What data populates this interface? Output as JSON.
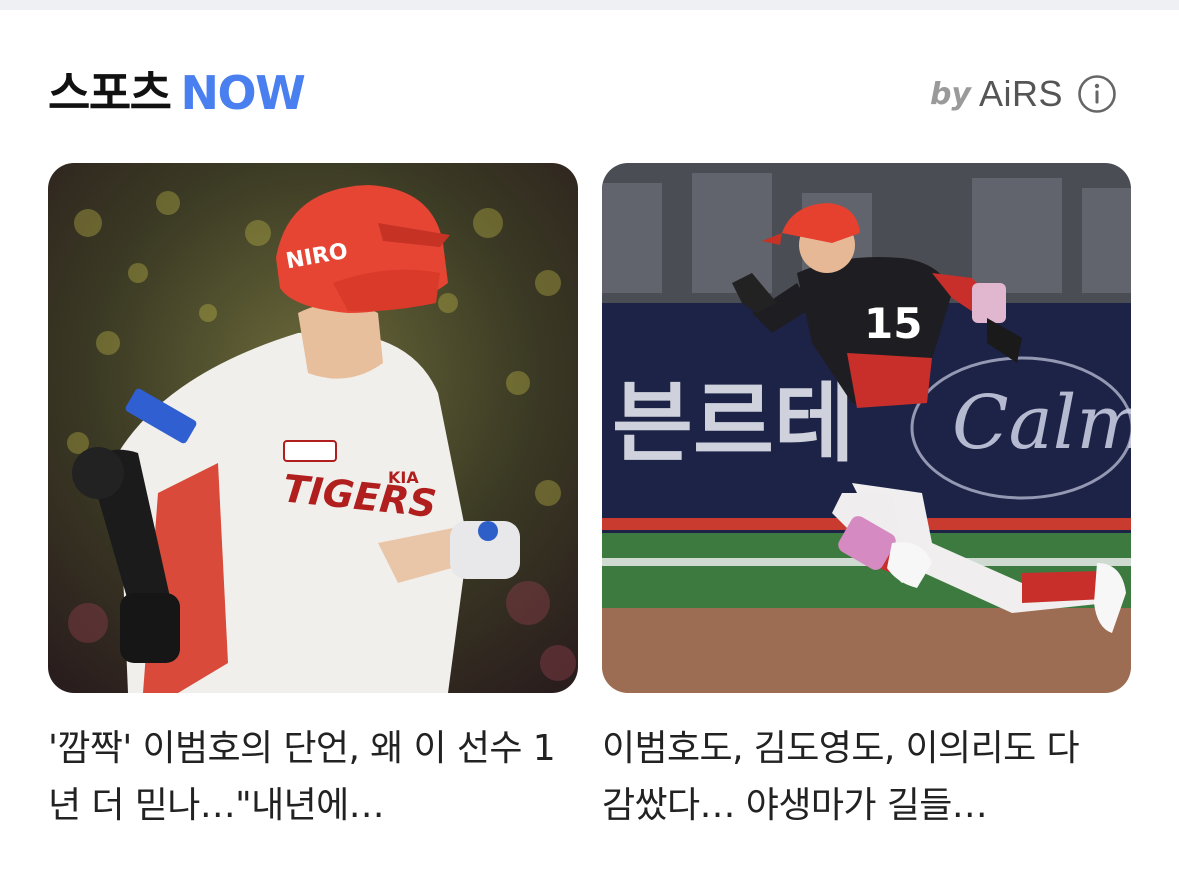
{
  "section": {
    "title_main": "스포츠",
    "title_accent": "NOW",
    "provider_by": "by",
    "provider_name": "AiRS",
    "accent_color": "#4a7ff0"
  },
  "cards": [
    {
      "headline": "'깜짝' 이범호의 단언, 왜 이 선수 1년 더 믿나…\"내년에…",
      "image_icon": "baseball-player-photo"
    },
    {
      "headline": "이범호도, 김도영도, 이의리도 다 감쌌다… 야생마가 길들…",
      "image_icon": "baseball-runner-photo"
    }
  ],
  "icons": {
    "info": "info-icon"
  }
}
